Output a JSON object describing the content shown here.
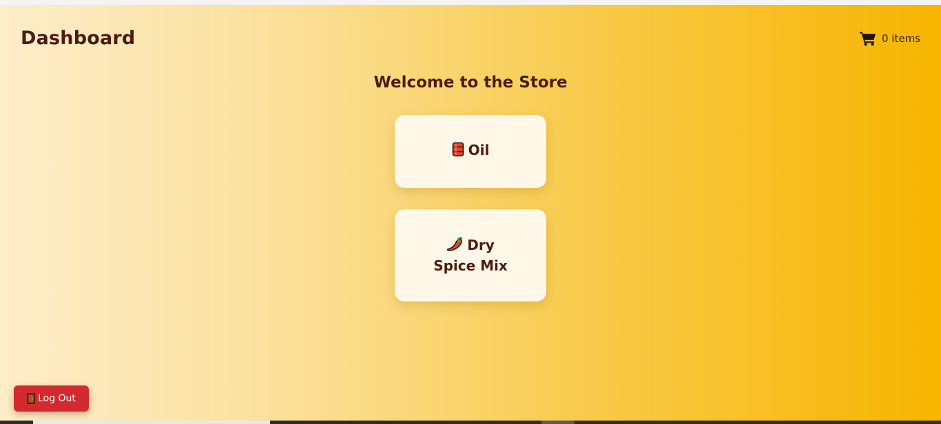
{
  "header": {
    "title": "Dashboard",
    "cart_label": "0 items",
    "cart_icon": "shopping-cart-icon"
  },
  "main": {
    "welcome": "Welcome to the Store",
    "products": [
      {
        "name": "Oil",
        "icon": "oil-drum-icon"
      },
      {
        "name": "Dry Spice Mix",
        "icon": "chili-pepper-icon"
      }
    ]
  },
  "footer": {
    "logout_label": "Log Out",
    "logout_icon": "door-icon"
  },
  "colors": {
    "title_text": "#4a1c14",
    "card_bg": "#fff8e9",
    "logout_bg": "#d32a2f",
    "gradient_start": "#fdedc9",
    "gradient_end": "#f7b500"
  }
}
